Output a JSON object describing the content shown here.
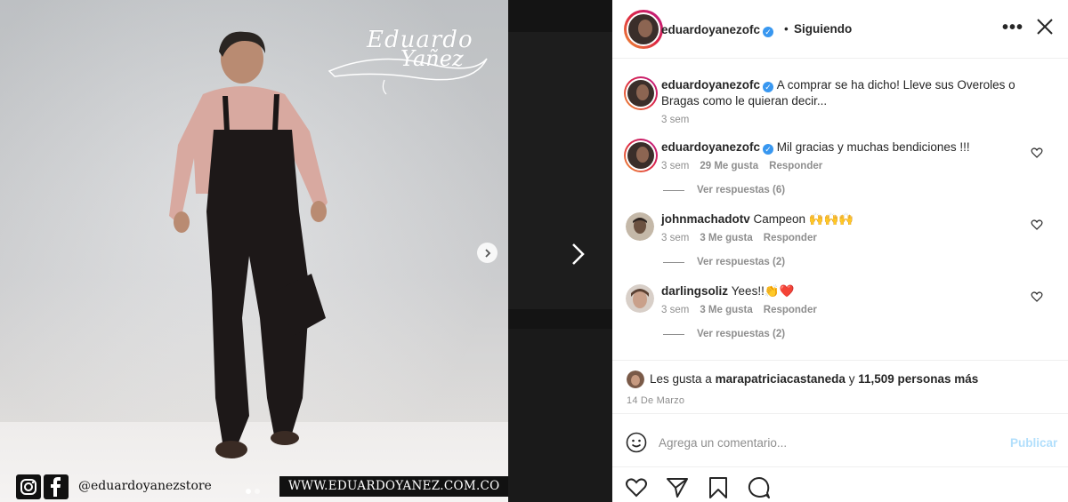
{
  "media": {
    "signature_line1": "Eduardo",
    "signature_line2": "Yañez",
    "store_handle": "@eduardoyanezstore",
    "website": "WWW.EDUARDOYANEZ.COM.CO",
    "slide_count": 2,
    "current_slide": 1
  },
  "header": {
    "username": "eduardoyanezofc",
    "separator": "•",
    "follow_status": "Siguiendo"
  },
  "comments": [
    {
      "username": "eduardoyanezofc",
      "verified": true,
      "text": "A comprar se ha dicho! Lleve sus Overoles o Bragas como le quieran decir...",
      "time": "3 sem"
    },
    {
      "username": "eduardoyanezofc",
      "verified": true,
      "text": "Mil gracias y muchas bendiciones !!!",
      "time": "3 sem",
      "likes": "29 Me gusta",
      "reply": "Responder",
      "view_replies": "Ver respuestas (6)"
    },
    {
      "username": "johnmachadotv",
      "verified": false,
      "text": "Campeon 🙌🙌🙌",
      "time": "3 sem",
      "likes": "3 Me gusta",
      "reply": "Responder",
      "view_replies": "Ver respuestas (2)"
    },
    {
      "username": "darlingsoliz",
      "verified": false,
      "text": "Yees!!👏❤️",
      "time": "3 sem",
      "likes": "3 Me gusta",
      "reply": "Responder",
      "view_replies": "Ver respuestas (2)"
    }
  ],
  "likes": {
    "prefix": "Les gusta a",
    "user": "marapatriciacastaneda",
    "connector": "y",
    "others": "11,509 personas más",
    "date": "14 De Marzo"
  },
  "composer": {
    "placeholder": "Agrega un comentario...",
    "publish_label": "Publicar"
  },
  "colors": {
    "verified": "#3897f0",
    "publish_disabled": "#b2dffc",
    "muted_text": "#8e8e8e"
  }
}
